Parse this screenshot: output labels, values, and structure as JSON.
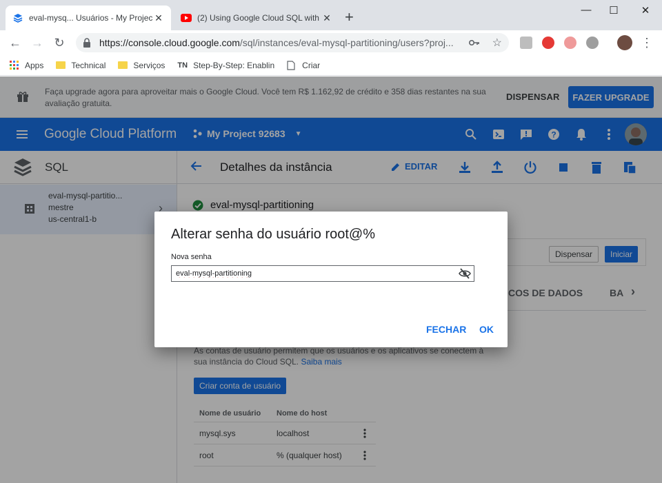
{
  "browser": {
    "tabs": [
      {
        "title": "eval-mysq... Usuários - My Projec",
        "active": true
      },
      {
        "title": "(2) Using Google Cloud SQL with",
        "active": false
      }
    ],
    "url_host": "https://console.cloud.google.com",
    "url_path": "/sql/instances/eval-mysql-partitioning/users?proj...",
    "bookmarks": [
      {
        "label": "Apps",
        "icon": "apps-grid-icon"
      },
      {
        "label": "Technical",
        "icon": "folder-icon"
      },
      {
        "label": "Serviços",
        "icon": "folder-icon"
      },
      {
        "label": "Step-By-Step: Enablin",
        "icon": "tn-icon",
        "prefix": "TN"
      },
      {
        "label": "Criar",
        "icon": "page-icon"
      }
    ]
  },
  "banner": {
    "text": "Faça upgrade agora para aproveitar mais o Google Cloud. Você tem R$ 1.162,92 de crédito e 358 dias restantes na sua avaliação gratuita.",
    "dismiss_label": "DISPENSAR",
    "upgrade_label": "FAZER UPGRADE"
  },
  "appbar": {
    "brand": "Google Cloud Platform",
    "project": "My Project 92683",
    "accent": "#1a73e8"
  },
  "sidebar": {
    "title": "SQL",
    "instance": {
      "name": "eval-mysql-partitio...",
      "role": "mestre",
      "region": "us-central1-b"
    }
  },
  "main": {
    "title": "Detalhes da instância",
    "edit_label": "EDITAR",
    "instance_status": "eval-mysql-partitioning",
    "panel": {
      "dismiss_label": "Dispensar",
      "start_label": "Iniciar"
    },
    "tabs": {
      "databases": "COS DE DADOS",
      "backups": "BA"
    },
    "description": "As contas de usuário permitem que os usuários e os aplicativos se conectem à sua instância do Cloud SQL.",
    "learn_more": "Saiba mais",
    "create_user_label": "Criar conta de usuário",
    "users_table": {
      "headers": [
        "Nome de usuário",
        "Nome do host"
      ],
      "rows": [
        [
          "mysql.sys",
          "localhost"
        ],
        [
          "root",
          "% (qualquer host)"
        ]
      ]
    }
  },
  "dialog": {
    "title": "Alterar senha do usuário root@%",
    "field_label": "Nova senha",
    "field_value": "eval-mysql-partitioning",
    "close_label": "FECHAR",
    "ok_label": "OK"
  }
}
